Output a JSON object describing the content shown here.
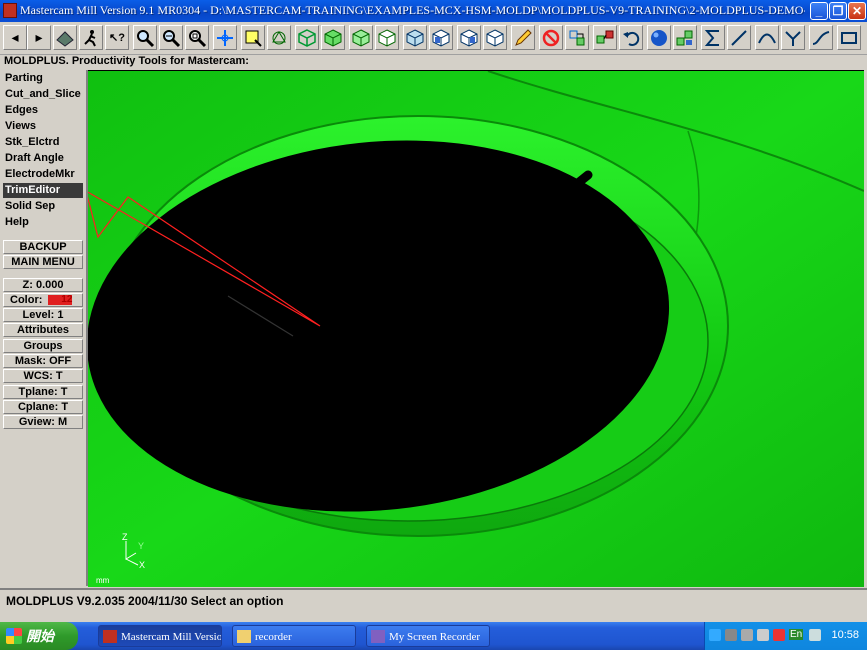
{
  "window": {
    "title": "Mastercam Mill Version 9.1 MR0304 - D:\\MASTERCAM-TRAINING\\EXAMPLES-MCX-HSM-MOLDP\\MOLDPLUS-V9-TRAINING\\2-MOLDPLUS-DEMO-FILES\\3-...",
    "minimize": "_",
    "restore": "❐",
    "close": "✕"
  },
  "toolbar": {
    "back": "◂",
    "forward": "▸",
    "help": "↖?"
  },
  "prompt": "MOLDPLUS. Productivity Tools for Mastercam:",
  "menu": {
    "items": [
      {
        "label": "Parting"
      },
      {
        "label": "Cut_and_Slice"
      },
      {
        "label": "Edges"
      },
      {
        "label": "Views"
      },
      {
        "label": "Stk_Elctrd"
      },
      {
        "label": "Draft Angle"
      },
      {
        "label": "ElectrodeMkr"
      },
      {
        "label": "TrimEditor"
      },
      {
        "label": "Solid Sep"
      },
      {
        "label": "Help"
      }
    ],
    "backup": "BACKUP",
    "main_menu": "MAIN MENU"
  },
  "settings": {
    "z": "Z:   0.000",
    "color_label": "Color:",
    "color_value": "12",
    "level": "Level:  1",
    "attributes": "Attributes",
    "groups": "Groups",
    "mask": "Mask:  OFF",
    "wcs": "WCS:   T",
    "tplane": "Tplane:  T",
    "cplane": "Cplane:  T",
    "gview": "Gview:   M"
  },
  "viewport": {
    "axis_z": "Z",
    "axis_y": "Y",
    "axis_x": "X",
    "units": "mm"
  },
  "status": "MOLDPLUS V9.2.035 2004/11/30 Select an option",
  "taskbar": {
    "start": "開始",
    "tasks": [
      {
        "label": "Mastercam Mill Versio..."
      },
      {
        "label": "recorder"
      },
      {
        "label": "My Screen Recorder"
      }
    ],
    "lang": "En",
    "clock": "10:58"
  },
  "colors": {
    "viewport_green": "#14d214",
    "selection": "#3a3a3a",
    "color_swatch": "#e02020",
    "taskbar_blue": "#245edb"
  }
}
